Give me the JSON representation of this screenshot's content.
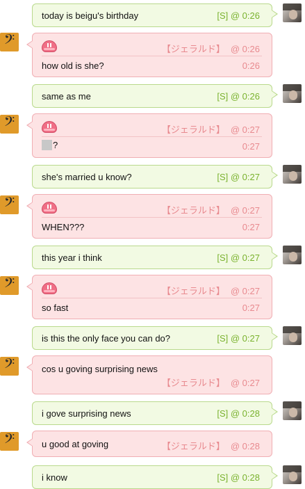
{
  "me_tag": "[S]",
  "them_name": "【ジェラルド】",
  "messages": [
    {
      "from": "me",
      "text": "today is beigu's birthday",
      "time": "@ 0:26"
    },
    {
      "from": "them",
      "text": "how old is she?",
      "time": "@ 0:26",
      "time2": "0:26",
      "emoticon": "blush-face"
    },
    {
      "from": "me",
      "text": "same as me",
      "time": "@ 0:26"
    },
    {
      "from": "them",
      "text": "?",
      "time": "@ 0:27",
      "time2": "0:27",
      "emoticon": "blush-face",
      "leading_placeholder": true
    },
    {
      "from": "me",
      "text": "she's married u know?",
      "time": "@ 0:27"
    },
    {
      "from": "them",
      "text": "WHEN???",
      "time": "@ 0:27",
      "time2": "0:27",
      "emoticon": "blush-face"
    },
    {
      "from": "me",
      "text": "this year i think",
      "time": "@ 0:27"
    },
    {
      "from": "them",
      "text": "so fast",
      "time": "@ 0:27",
      "time2": "0:27",
      "emoticon": "blush-face"
    },
    {
      "from": "me",
      "text": "is this the only face you can do?",
      "time": "@ 0:27"
    },
    {
      "from": "them",
      "text": "cos u goving surprising news",
      "time": "@ 0:27"
    },
    {
      "from": "me",
      "text": "i gove surprising news",
      "time": "@ 0:28"
    },
    {
      "from": "them",
      "text": "u good at goving",
      "time": "@ 0:28"
    },
    {
      "from": "me",
      "text": "i know",
      "time": "@ 0:28"
    }
  ],
  "colors": {
    "me_bubble": "#f2fae3",
    "me_border": "#b9d98c",
    "me_meta": "#7ab22e",
    "them_bubble": "#fde3e4",
    "them_border": "#f0aeb3",
    "them_meta": "#e88a8f"
  }
}
